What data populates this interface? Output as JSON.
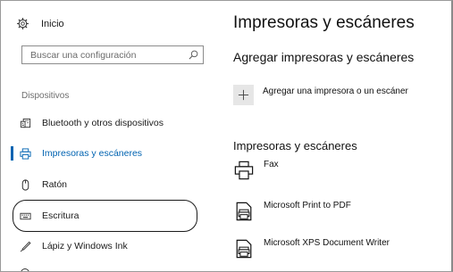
{
  "window": {
    "home_label": "Inicio",
    "search_placeholder": "Buscar una configuración",
    "section_label": "Dispositivos"
  },
  "sidebar": {
    "items": [
      {
        "label": "Bluetooth y otros dispositivos",
        "icon": "keyboard-icon",
        "selected": false
      },
      {
        "label": "Impresoras y escáneres",
        "icon": "printer-icon",
        "selected": true
      },
      {
        "label": "Ratón",
        "icon": "mouse-icon",
        "selected": false
      },
      {
        "label": "Escritura",
        "icon": "keyboard-icon",
        "selected": false,
        "circled": true
      },
      {
        "label": "Lápiz y Windows Ink",
        "icon": "pen-icon",
        "selected": false
      }
    ]
  },
  "main": {
    "title": "Impresoras y escáneres",
    "add_section_title": "Agregar impresoras y escáneres",
    "add_button_label": "Agregar una impresora o un escáner",
    "list_title": "Impresoras y escáneres",
    "printers": [
      {
        "name": "Fax",
        "icon": "fax-printer-icon"
      },
      {
        "name": "Microsoft Print to PDF",
        "icon": "document-printer-icon"
      },
      {
        "name": "Microsoft XPS Document Writer",
        "icon": "document-printer-icon"
      }
    ]
  },
  "colors": {
    "accent": "#0063b1",
    "text": "#1a1a1a",
    "muted": "#6e6e6e",
    "tile_bg": "#e6e6e6"
  }
}
